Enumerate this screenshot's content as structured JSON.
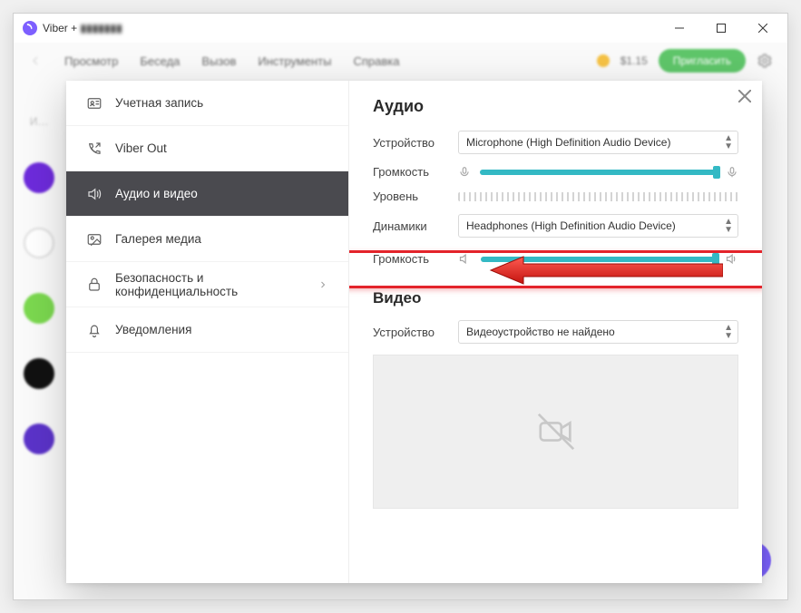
{
  "window": {
    "title_prefix": "Viber +",
    "title_masked": "▮▮▮▮▮▮▮"
  },
  "menu": {
    "view": "Просмотр",
    "chat": "Беседа",
    "call": "Вызов",
    "tools": "Инструменты",
    "help": "Справка"
  },
  "topright": {
    "balance": "$1.15",
    "action": "Пригласить"
  },
  "sidebar": {
    "account": "Учетная запись",
    "viber_out": "Viber Out",
    "audio_video": "Аудио и видео",
    "media": "Галерея медиа",
    "security": "Безопасность и конфиденциальность",
    "notifications": "Уведомления"
  },
  "pane": {
    "audio_heading": "Аудио",
    "video_heading": "Видео",
    "device_label": "Устройство",
    "volume_label": "Громкость",
    "level_label": "Уровень",
    "speakers_label": "Динамики",
    "mic_device": "Microphone (High Definition Audio Device)",
    "spk_device": "Headphones (High Definition Audio Device)",
    "video_device": "Видеоустройство не найдено",
    "mic_volume_pct": 100,
    "spk_volume_pct": 100
  }
}
